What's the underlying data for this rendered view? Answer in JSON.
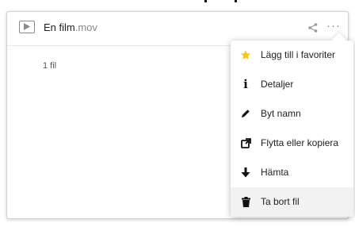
{
  "file": {
    "name": "En film",
    "extension": ".mov",
    "count_text": "1 fil"
  },
  "menu": {
    "items": [
      {
        "label": "Lägg till i favoriter",
        "icon": "star-icon"
      },
      {
        "label": "Detaljer",
        "icon": "info-icon"
      },
      {
        "label": "Byt namn",
        "icon": "pencil-icon"
      },
      {
        "label": "Flytta eller kopiera",
        "icon": "external-link-icon"
      },
      {
        "label": "Hämta",
        "icon": "download-icon"
      },
      {
        "label": "Ta bort fil",
        "icon": "trash-icon"
      }
    ]
  },
  "colors": {
    "star": "#f5c518",
    "icon": "#111111",
    "muted": "#888888"
  }
}
